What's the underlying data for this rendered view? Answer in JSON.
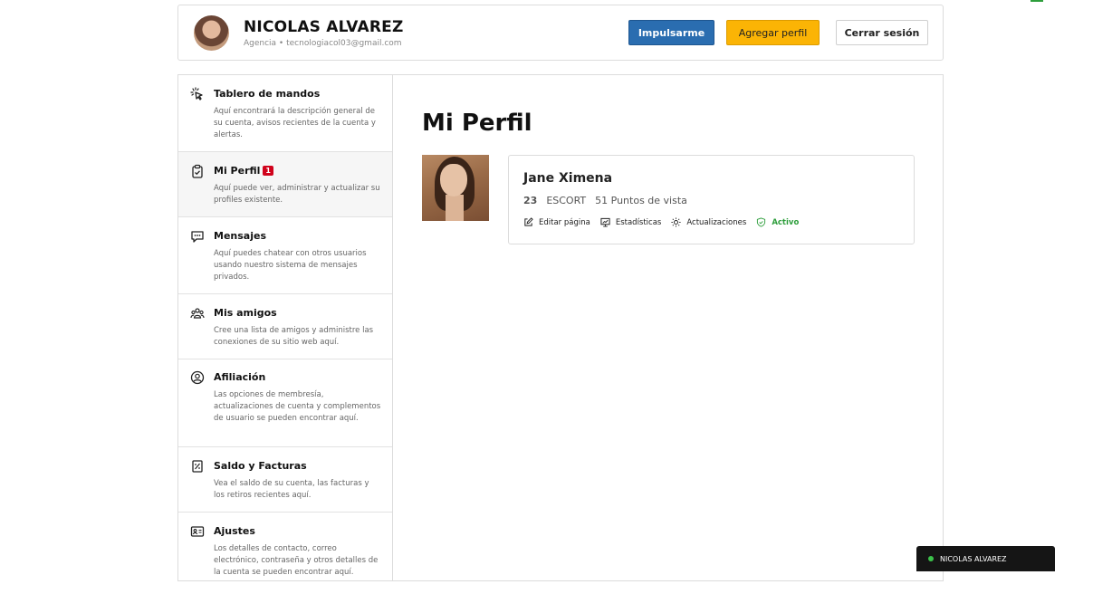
{
  "header": {
    "user_name": "NICOLAS ALVAREZ",
    "user_sub": "Agencia • tecnologiacol03@gmail.com",
    "boost_label": "Impulsarme",
    "add_profile_label": "Agregar perfil",
    "logout_label": "Cerrar sesión"
  },
  "sidebar": {
    "items": [
      {
        "title": "Tablero de mandos",
        "desc": "Aquí encontrará la descripción general de su cuenta, avisos recientes de la cuenta y alertas.",
        "icon": "pointer-click-icon"
      },
      {
        "title": "Mi Perfil",
        "badge": "1",
        "desc": "Aquí puede ver, administrar y actualizar su profiles existente.",
        "icon": "clipboard-check-icon"
      },
      {
        "title": "Mensajes",
        "desc": "Aquí puedes chatear con otros usuarios usando nuestro sistema de mensajes privados.",
        "icon": "chat-icon"
      },
      {
        "title": "Mis amigos",
        "desc": "Cree una lista de amigos y administre las conexiones de su sitio web aquí.",
        "icon": "friends-icon"
      },
      {
        "title": "Afiliación",
        "desc": "Las opciones de membresía, actualizaciones de cuenta y complementos de usuario se pueden encontrar aquí.",
        "icon": "user-circle-icon"
      },
      {
        "title": "Saldo y Facturas",
        "desc": "Vea el saldo de su cuenta, las facturas y los retiros recientes aquí.",
        "icon": "receipt-icon"
      },
      {
        "title": "Ajustes",
        "desc": "Los detalles de contacto, correo electrónico, contraseña y otros detalles de la cuenta se pueden encontrar aquí.",
        "icon": "id-card-icon"
      }
    ]
  },
  "main": {
    "page_title": "Mi Perfil",
    "profile": {
      "name": "Jane Ximena",
      "age": "23",
      "category": "ESCORT",
      "views": "51 Puntos de vista",
      "edit_label": "Editar página",
      "stats_label": "Estadísticas",
      "updates_label": "Actualizaciones",
      "status_label": "Activo"
    }
  },
  "chat": {
    "name": "NICOLAS ALVAREZ",
    "status_color": "#3cc34b"
  },
  "colors": {
    "boost_button": "#2a6db0",
    "add_button": "#fbb405",
    "active_status": "#2e9e3c",
    "badge": "#d0021b"
  }
}
